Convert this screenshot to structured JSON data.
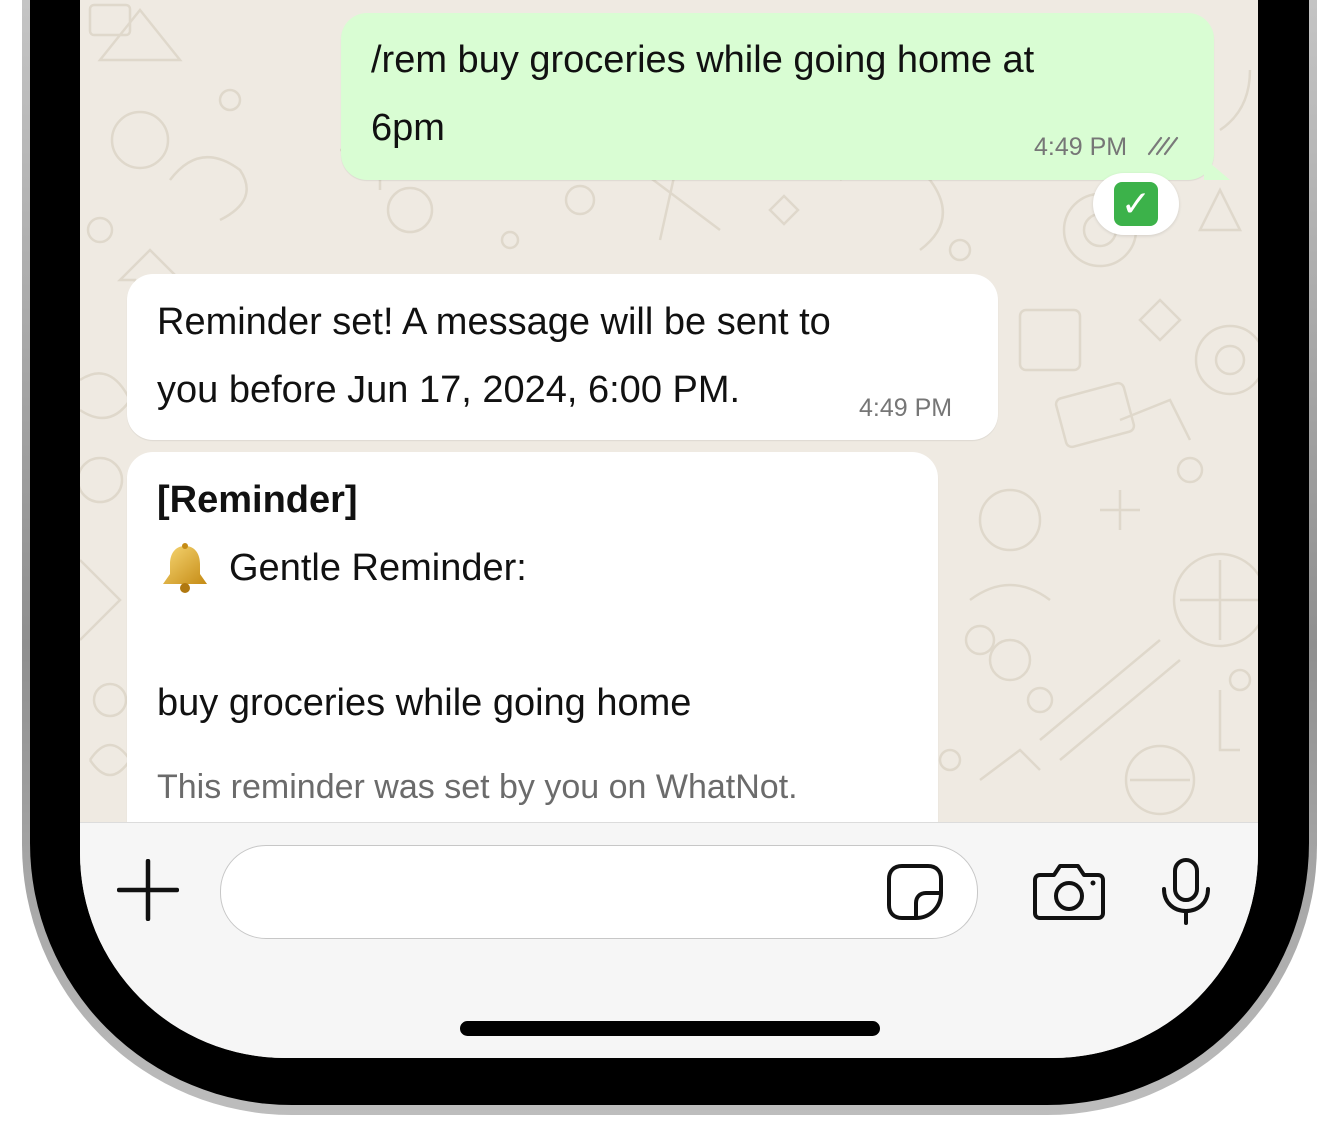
{
  "chat": {
    "outgoing_message": {
      "line1": "/rem buy groceries while going home at",
      "line2": "6pm",
      "time": "4:49 PM",
      "status_icon": "double-check-icon",
      "reaction": "✓"
    },
    "confirmation_message": {
      "line1": "Reminder set! A message will be sent to",
      "line2": "you before Jun 17, 2024, 6:00 PM.",
      "time": "4:49 PM"
    },
    "reminder_message": {
      "title": "[Reminder]",
      "icon": "bell-icon",
      "subtitle": "Gentle Reminder:",
      "body": "buy groceries while going home",
      "footnote": "This reminder was set by you on WhatNot."
    }
  },
  "composer": {
    "attach_icon": "plus-icon",
    "input_value": "",
    "sticker_icon": "sticker-icon",
    "camera_icon": "camera-icon",
    "mic_icon": "microphone-icon"
  },
  "colors": {
    "outgoing_bubble": "#d9fdd3",
    "incoming_bubble": "#ffffff",
    "chat_background": "#efeae2",
    "reaction_green": "#3cb24a"
  }
}
